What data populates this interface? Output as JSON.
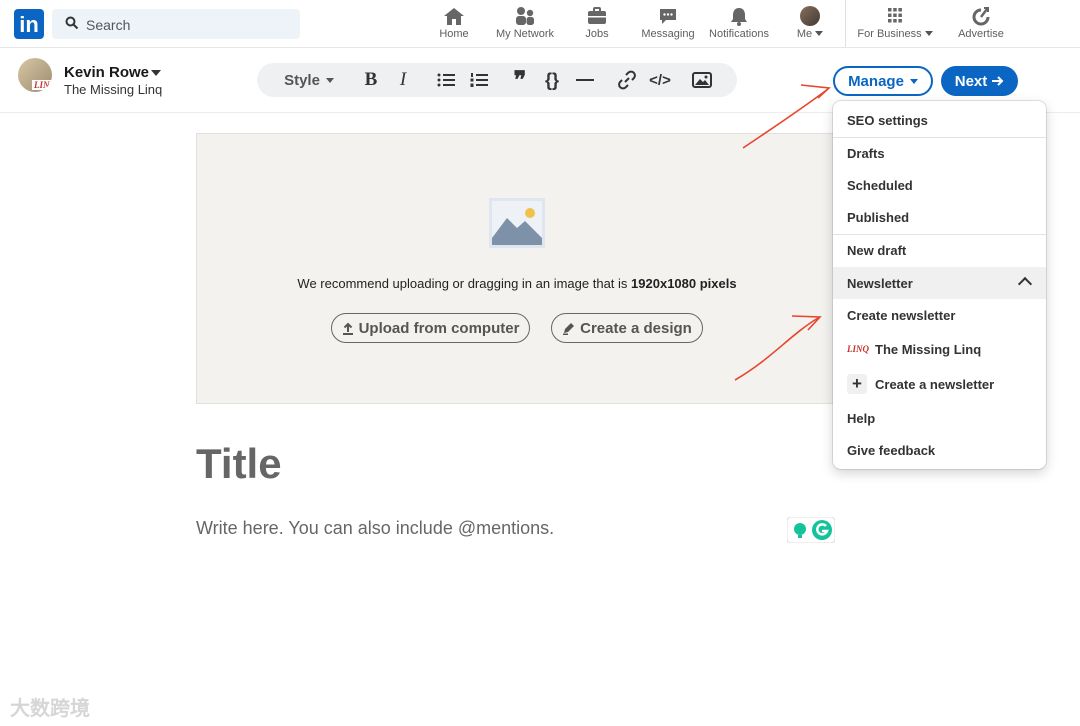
{
  "nav": {
    "logo": "in",
    "search_placeholder": "Search",
    "items": [
      {
        "label": "Home",
        "icon": "home-icon"
      },
      {
        "label": "My Network",
        "icon": "network-icon"
      },
      {
        "label": "Jobs",
        "icon": "briefcase-icon"
      },
      {
        "label": "Messaging",
        "icon": "messaging-icon"
      },
      {
        "label": "Notifications",
        "icon": "bell-icon"
      },
      {
        "label": "Me",
        "icon": "profile-photo"
      }
    ],
    "business": "For Business",
    "advertise": "Advertise"
  },
  "author": {
    "name": "Kevin Rowe",
    "page": "The Missing Linq",
    "logo_text": "LINQ"
  },
  "toolbar": {
    "style_label": "Style"
  },
  "actions": {
    "manage": "Manage",
    "next": "Next"
  },
  "cover": {
    "recommend_text": "We recommend uploading or dragging in an image that is",
    "recommend_bold": "1920x1080 pixels",
    "upload": "Upload from computer",
    "design": "Create a design"
  },
  "editor": {
    "title_placeholder": "Title",
    "body_placeholder": "Write here. You can also include @mentions."
  },
  "menu": {
    "seo": "SEO settings",
    "drafts": "Drafts",
    "scheduled": "Scheduled",
    "published": "Published",
    "new_draft": "New draft",
    "newsletter": "Newsletter",
    "create_newsletter": "Create newsletter",
    "missing_linq": "The Missing Linq",
    "create_a_newsletter": "Create a newsletter",
    "help": "Help",
    "feedback": "Give feedback"
  },
  "watermark": "大数跨境",
  "colors": {
    "brand": "#0a66c2",
    "annotation": "#e8452c"
  }
}
